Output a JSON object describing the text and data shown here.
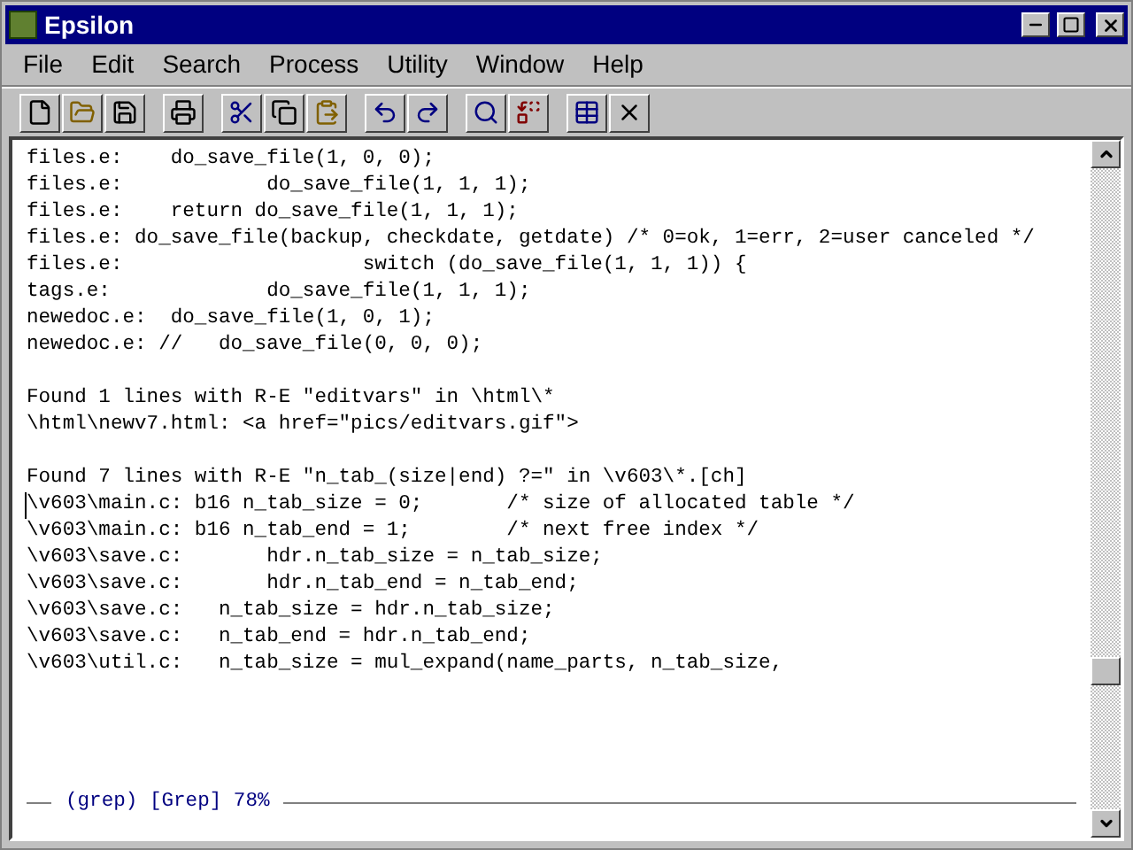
{
  "window": {
    "title": "Epsilon"
  },
  "menu": [
    "File",
    "Edit",
    "Search",
    "Process",
    "Utility",
    "Window",
    "Help"
  ],
  "editor": {
    "blocks": [
      {
        "lines": [
          {
            "text": "files.e:    do_save_file(1, 0, 0);",
            "cursor": false
          },
          {
            "text": "files.e:            do_save_file(1, 1, 1);",
            "cursor": false
          },
          {
            "text": "files.e:    return do_save_file(1, 1, 1);",
            "cursor": false
          },
          {
            "text": "files.e: do_save_file(backup, checkdate, getdate) /* 0=ok, 1=err, 2=user canceled */",
            "cursor": false
          },
          {
            "text": "files.e:                    switch (do_save_file(1, 1, 1)) {",
            "cursor": false
          },
          {
            "text": "tags.e:             do_save_file(1, 1, 1);",
            "cursor": false
          },
          {
            "text": "newedoc.e:  do_save_file(1, 0, 1);",
            "cursor": false
          },
          {
            "text": "newedoc.e: //   do_save_file(0, 0, 0);",
            "cursor": false
          }
        ]
      },
      {
        "heading": "Found 1 lines with R-E \"editvars\" in \\html\\*",
        "lines": [
          {
            "text": "\\html\\newv7.html: <a href=\"pics/editvars.gif\">",
            "cursor": false
          }
        ]
      },
      {
        "heading": "Found 7 lines with R-E \"n_tab_(size|end) ?=\" in \\v603\\*.[ch]",
        "lines": [
          {
            "text": "\\v603\\main.c: b16 n_tab_size = 0;       /* size of allocated table */",
            "cursor": true
          },
          {
            "text": "\\v603\\main.c: b16 n_tab_end = 1;        /* next free index */",
            "cursor": false
          },
          {
            "text": "\\v603\\save.c:       hdr.n_tab_size = n_tab_size;",
            "cursor": false
          },
          {
            "text": "\\v603\\save.c:       hdr.n_tab_end = n_tab_end;",
            "cursor": false
          },
          {
            "text": "\\v603\\save.c:   n_tab_size = hdr.n_tab_size;",
            "cursor": false
          },
          {
            "text": "\\v603\\save.c:   n_tab_end = hdr.n_tab_end;",
            "cursor": false
          },
          {
            "text": "\\v603\\util.c:   n_tab_size = mul_expand(name_parts, n_tab_size,",
            "cursor": false
          }
        ]
      }
    ],
    "mode_line": "(grep) [Grep] 78%"
  }
}
